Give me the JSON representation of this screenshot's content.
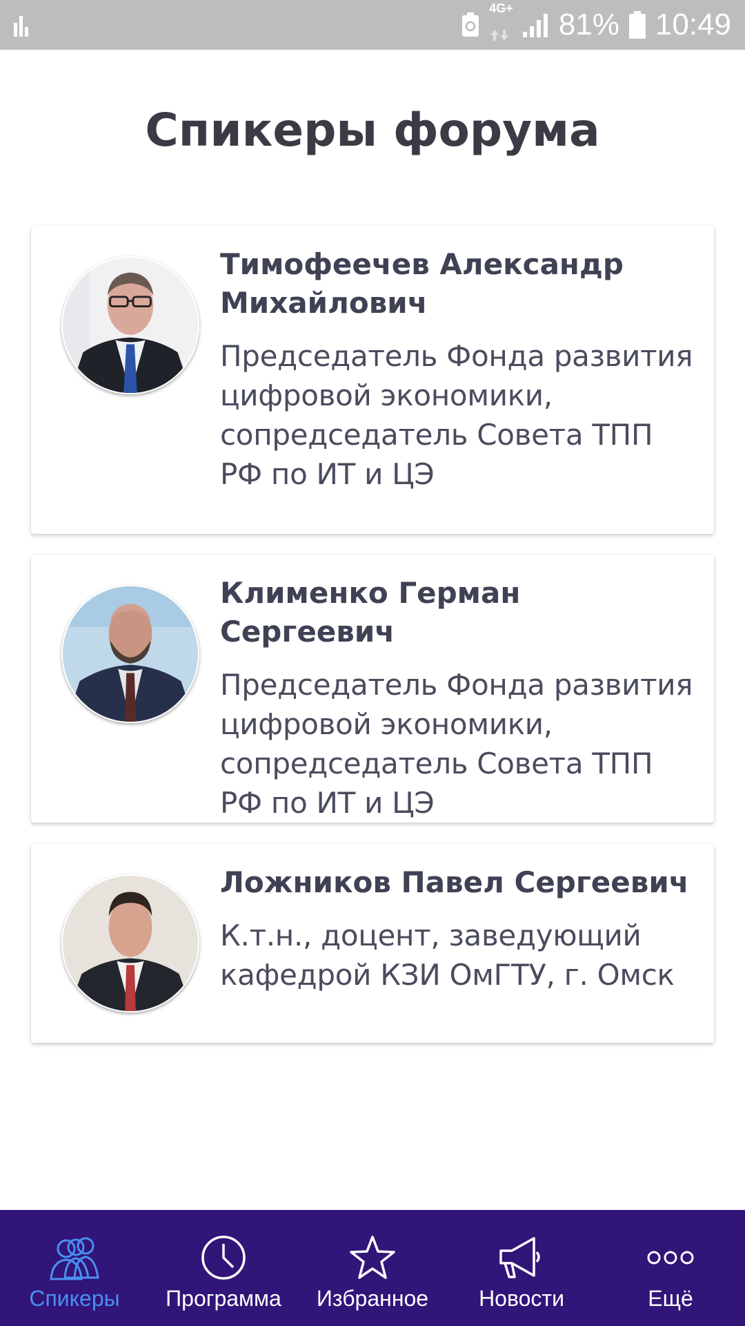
{
  "status_bar": {
    "network_type": "4G+",
    "battery_percent": "81%",
    "time": "10:49",
    "icons": [
      "stats-icon",
      "battery-saver-icon",
      "network-arrows-icon",
      "signal-icon",
      "battery-icon"
    ]
  },
  "page": {
    "title": "Спикеры форума"
  },
  "speakers": [
    {
      "name": "Тимофеечев Александр Михайлович",
      "description": "Председатель Фонда развития цифровой экономики, сопредседатель Совета ТПП РФ по ИТ и ЦЭ"
    },
    {
      "name": "Клименко Герман Сергеевич",
      "description": "Председатель Фонда развития цифровой экономики, сопредседатель Совета ТПП РФ по ИТ и ЦЭ"
    },
    {
      "name": "Ложников Павел Сергеевич",
      "description": "К.т.н., доцент, заведующий кафедрой КЗИ ОмГТУ, г. Омск"
    }
  ],
  "bottom_nav": {
    "items": [
      {
        "label": "Спикеры",
        "icon": "people-icon",
        "active": true
      },
      {
        "label": "Программа",
        "icon": "clock-icon",
        "active": false
      },
      {
        "label": "Избранное",
        "icon": "star-icon",
        "active": false
      },
      {
        "label": "Новости",
        "icon": "megaphone-icon",
        "active": false
      },
      {
        "label": "Ещё",
        "icon": "more-icon",
        "active": false
      }
    ]
  },
  "colors": {
    "status_bar_bg": "#bdbdbd",
    "nav_bg": "#311579",
    "nav_active": "#4a8ff0",
    "title_text": "#3a3b45"
  }
}
